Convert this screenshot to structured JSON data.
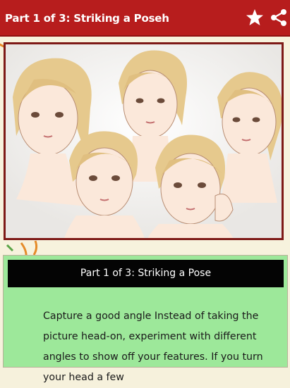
{
  "appbar": {
    "title": "Part 1 of 3: Striking a Poseh",
    "actions": [
      {
        "icon": "star-icon",
        "label": "favorite"
      },
      {
        "icon": "share-icon",
        "label": "share"
      }
    ]
  },
  "illustration": {
    "subject": "five faces at different angles"
  },
  "step_card": {
    "heading": "Part 1 of 3: Striking a Pose",
    "text": "Capture a good angle Instead of taking the picture head-on, experiment with different angles to show off your features. If you turn your head a few"
  },
  "colors": {
    "appbar": "#b71d1d",
    "image_border": "#7e1a17",
    "card_bg": "#9de89a",
    "card_header": "#040404",
    "page_bg": "#f7f2dd"
  }
}
